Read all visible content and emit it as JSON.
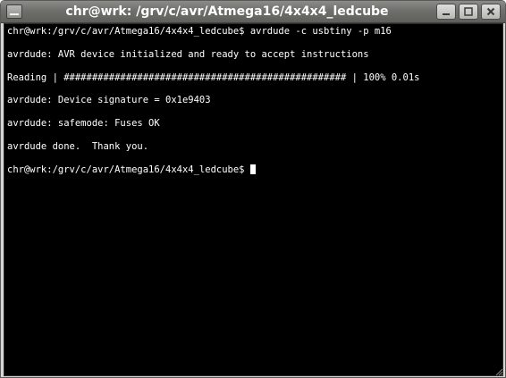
{
  "window": {
    "title": "chr@wrk: /grv/c/avr/Atmega16/4x4x4_ledcube",
    "controls": {
      "menu_icon": "window-menu-icon",
      "minimize_icon": "minimize-icon",
      "maximize_icon": "maximize-icon",
      "close_icon": "close-icon"
    }
  },
  "terminal": {
    "colors": {
      "background": "#000000",
      "foreground": "#ffffff"
    },
    "lines": [
      "chr@wrk:/grv/c/avr/Atmega16/4x4x4_ledcube$ avrdude -c usbtiny -p m16",
      "",
      "avrdude: AVR device initialized and ready to accept instructions",
      "",
      "Reading | ################################################## | 100% 0.01s",
      "",
      "avrdude: Device signature = 0x1e9403",
      "",
      "avrdude: safemode: Fuses OK",
      "",
      "avrdude done.  Thank you.",
      "",
      "chr@wrk:/grv/c/avr/Atmega16/4x4x4_ledcube$ "
    ]
  }
}
